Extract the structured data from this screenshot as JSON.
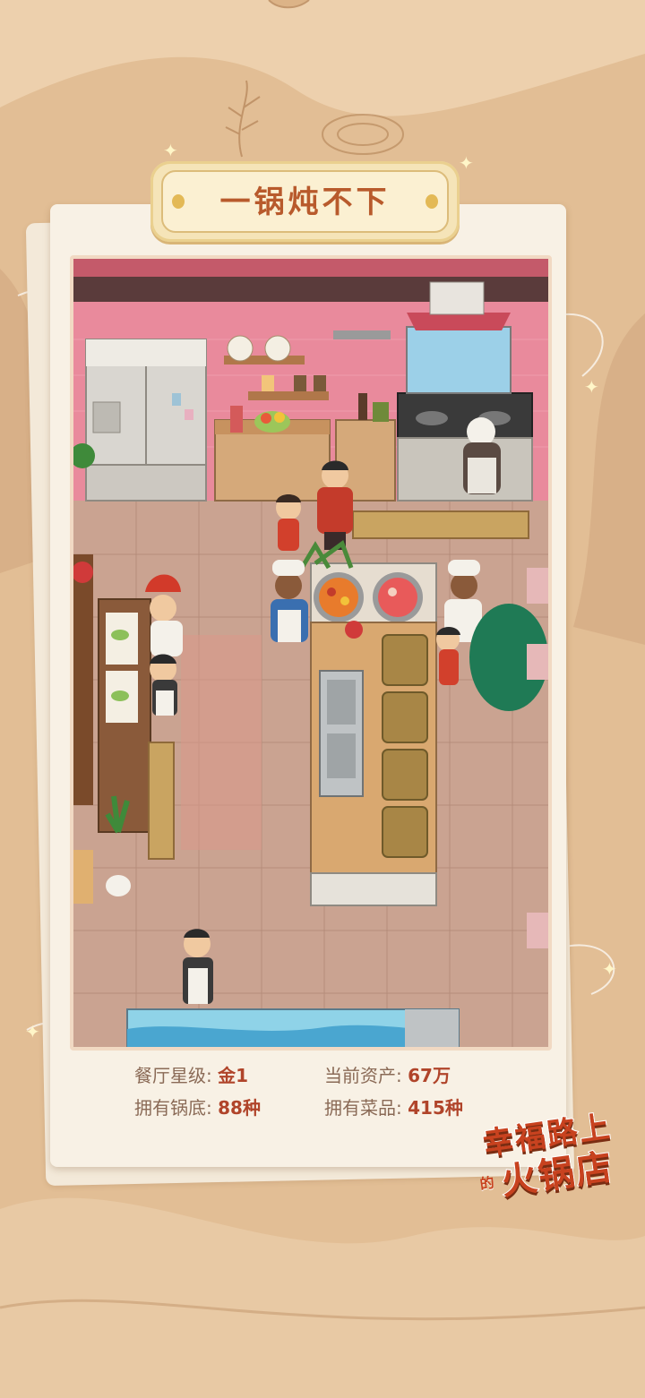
{
  "title": "一锅炖不下",
  "stats": {
    "star_label": "餐厅星级:",
    "star_value": "金1",
    "assets_label": "当前资产:",
    "assets_value": "67万",
    "pots_label": "拥有锅底:",
    "pots_value": "88种",
    "dishes_label": "拥有菜品:",
    "dishes_value": "415种"
  },
  "logo": {
    "line1": "幸福路上",
    "small": "的",
    "line2": "火锅店"
  },
  "colors": {
    "background": "#e2be95",
    "title_text": "#b85a2c",
    "stat_value": "#b0442a",
    "logo_red": "#c8421f"
  }
}
